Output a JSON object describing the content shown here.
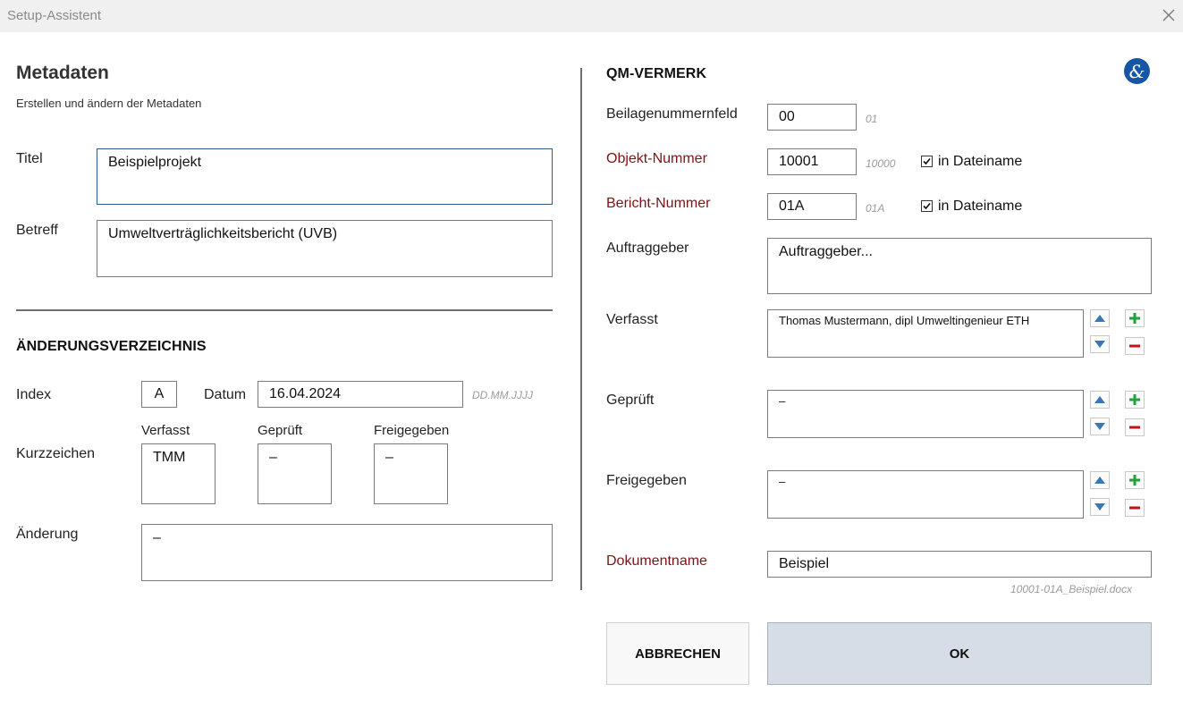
{
  "window": {
    "title": "Setup-Assistent"
  },
  "left": {
    "heading": "Metadaten",
    "subheading": "Erstellen und ändern der Metadaten",
    "titel_label": "Titel",
    "titel_value": "Beispielprojekt",
    "betreff_label": "Betreff",
    "betreff_value": "Umweltverträglichkeitsbericht (UVB)",
    "changes_heading": "ÄNDERUNGSVERZEICHNIS",
    "index_label": "Index",
    "index_value": "A",
    "datum_label": "Datum",
    "datum_value": "16.04.2024",
    "datum_hint": "DD.MM.JJJJ",
    "kurzzeichen_label": "Kurzzeichen",
    "verfasst_label": "Verfasst",
    "verfasst_value": "TMM",
    "geprueft_label": "Geprüft",
    "geprueft_value": "–",
    "freigegeben_label": "Freigegeben",
    "freigegeben_value": "–",
    "aenderung_label": "Änderung",
    "aenderung_value": "–"
  },
  "right": {
    "heading": "QM-VERMERK",
    "logo_glyph": "&",
    "beilage_label": "Beilagenummernfeld",
    "beilage_value": "00",
    "beilage_hint": "01",
    "objekt_label": "Objekt-Nummer",
    "objekt_value": "10001",
    "objekt_hint": "10000",
    "objekt_checkbox_label": "in Dateiname",
    "bericht_label": "Bericht-Nummer",
    "bericht_value": "01A",
    "bericht_hint": "01A",
    "bericht_checkbox_label": "in Dateiname",
    "auftraggeber_label": "Auftraggeber",
    "auftraggeber_value": "Auftraggeber...",
    "verfasst_label": "Verfasst",
    "verfasst_value": "Thomas Mustermann, dipl Umweltingenieur ETH",
    "geprueft_label": "Geprüft",
    "geprueft_value": "–",
    "freigegeben_label": "Freigegeben",
    "freigegeben_value": "–",
    "dokumentname_label": "Dokumentname",
    "dokumentname_value": "Beispiel",
    "filename_preview": "10001-01A_Beispiel.docx"
  },
  "buttons": {
    "cancel": "ABBRECHEN",
    "ok": "OK"
  },
  "colors": {
    "required_label": "#7b1416",
    "ok_button_bg": "#d6dde7",
    "arrow_blue": "#3a78b5",
    "plus_green": "#22a23a",
    "minus_red": "#c0141a",
    "logo_blue": "#1557a6"
  },
  "icons": {
    "close": "close-icon",
    "move_up": "arrow-up-icon",
    "move_down": "arrow-down-icon",
    "add": "plus-icon",
    "remove": "minus-icon",
    "logo": "ampersand-logo-icon",
    "checkbox": "checkmark-icon"
  }
}
